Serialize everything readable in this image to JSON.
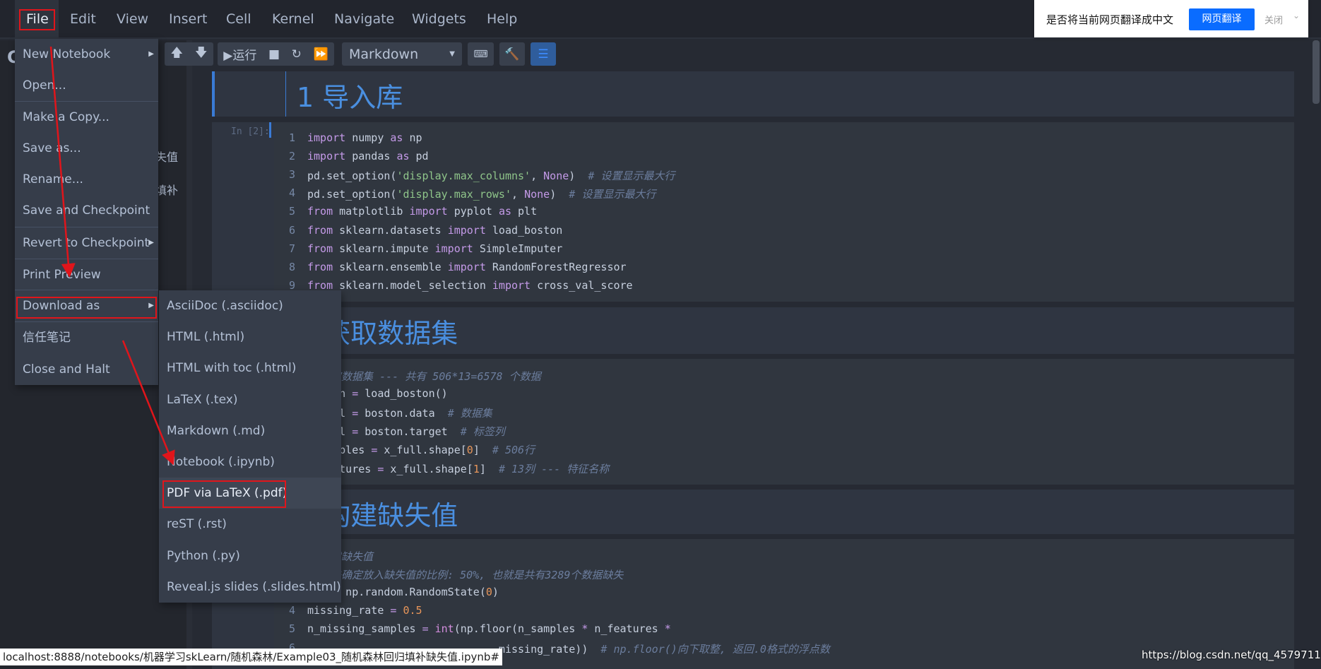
{
  "menubar": {
    "items": [
      "File",
      "Edit",
      "View",
      "Insert",
      "Cell",
      "Kernel",
      "Navigate",
      "Widgets",
      "Help"
    ]
  },
  "sidebar": {
    "letter": "C",
    "fragments": [
      "失值",
      "填补"
    ]
  },
  "toolbar": {
    "run_label": "运行",
    "cell_type": "Markdown",
    "icons": [
      "arrow-up-icon",
      "arrow-down-icon",
      "play-icon",
      "stop-icon",
      "restart-icon",
      "fast-forward-icon",
      "keyboard-icon",
      "hammer-icon",
      "list-icon"
    ],
    "active_color": "#2f5d9c"
  },
  "file_menu": {
    "items": [
      {
        "label": "New Notebook",
        "submenu": true
      },
      {
        "label": "Open..."
      },
      {
        "label": "Make a Copy..."
      },
      {
        "label": "Save as..."
      },
      {
        "label": "Rename..."
      },
      {
        "label": "Save and Checkpoint"
      },
      {
        "label": "Revert to Checkpoint",
        "submenu": true
      },
      {
        "label": "Print Preview"
      },
      {
        "label": "Download as",
        "submenu": true
      },
      {
        "label": "信任笔记"
      },
      {
        "label": "Close and Halt"
      }
    ]
  },
  "download_menu": {
    "items": [
      "AsciiDoc (.asciidoc)",
      "HTML (.html)",
      "HTML with toc (.html)",
      "LaTeX (.tex)",
      "Markdown (.md)",
      "Notebook (.ipynb)",
      "PDF via LaTeX (.pdf)",
      "reST (.rst)",
      "Python (.py)",
      "Reveal.js slides (.slides.html)"
    ],
    "highlighted": "PDF via LaTeX (.pdf)"
  },
  "notebook": {
    "headings": [
      "1  导入库",
      "2  获取数据集",
      "3  构建缺失值"
    ],
    "prompt": "In [2]:",
    "cell1": [
      [
        [
          "k",
          "import"
        ],
        [
          "t",
          " numpy "
        ],
        [
          "k",
          "as"
        ],
        [
          "t",
          " np"
        ]
      ],
      [
        [
          "k",
          "import"
        ],
        [
          "t",
          " pandas "
        ],
        [
          "k",
          "as"
        ],
        [
          "t",
          " pd"
        ]
      ],
      [
        [
          "t",
          "pd.set_option("
        ],
        [
          "s",
          "'display.max_columns'"
        ],
        [
          "t",
          ", "
        ],
        [
          "k",
          "None"
        ],
        [
          "t",
          ")  "
        ],
        [
          "c",
          "# 设置显示最大行"
        ]
      ],
      [
        [
          "t",
          "pd.set_option("
        ],
        [
          "s",
          "'display.max_rows'"
        ],
        [
          "t",
          ", "
        ],
        [
          "k",
          "None"
        ],
        [
          "t",
          ")  "
        ],
        [
          "c",
          "# 设置显示最大行"
        ]
      ],
      [
        [
          "k",
          "from"
        ],
        [
          "t",
          " matplotlib "
        ],
        [
          "k",
          "import"
        ],
        [
          "t",
          " pyplot "
        ],
        [
          "k",
          "as"
        ],
        [
          "t",
          " plt"
        ]
      ],
      [
        [
          "k",
          "from"
        ],
        [
          "t",
          " sklearn.datasets "
        ],
        [
          "k",
          "import"
        ],
        [
          "t",
          " load_boston"
        ]
      ],
      [
        [
          "k",
          "from"
        ],
        [
          "t",
          " sklearn.impute "
        ],
        [
          "k",
          "import"
        ],
        [
          "t",
          " SimpleImputer"
        ]
      ],
      [
        [
          "k",
          "from"
        ],
        [
          "t",
          " sklearn.ensemble "
        ],
        [
          "k",
          "import"
        ],
        [
          "t",
          " RandomForestRegressor"
        ]
      ],
      [
        [
          "k",
          "from"
        ],
        [
          "t",
          " sklearn.model_selection "
        ],
        [
          "k",
          "import"
        ],
        [
          "t",
          " cross_val_score"
        ]
      ]
    ],
    "cell2": [
      [
        [
          "c",
          "# 获取数据集 --- 共有 506*13=6578 个数据"
        ]
      ],
      [
        [
          "t",
          "boston "
        ],
        [
          "o",
          "="
        ],
        [
          "t",
          " load_boston()"
        ]
      ],
      [
        [
          "t",
          "x_full "
        ],
        [
          "o",
          "="
        ],
        [
          "t",
          " boston.data  "
        ],
        [
          "c",
          "# 数据集"
        ]
      ],
      [
        [
          "t",
          "y_full "
        ],
        [
          "o",
          "="
        ],
        [
          "t",
          " boston.target  "
        ],
        [
          "c",
          "# 标签列"
        ]
      ],
      [
        [
          "t",
          "n_samples "
        ],
        [
          "o",
          "="
        ],
        [
          "t",
          " x_full.shape["
        ],
        [
          "n",
          "0"
        ],
        [
          "t",
          "]  "
        ],
        [
          "c",
          "# 506行"
        ]
      ],
      [
        [
          "t",
          "n_features "
        ],
        [
          "o",
          "="
        ],
        [
          "t",
          " x_full.shape["
        ],
        [
          "n",
          "1"
        ],
        [
          "t",
          "]  "
        ],
        [
          "c",
          "# 13列 --- 特征名称"
        ]
      ]
    ],
    "cell3": [
      [
        [
          "c",
          "# 构建缺失值"
        ]
      ],
      [
        [
          "c",
          "# 首先确定放入缺失值的比例: 50%, 也就是共有3289个数据缺失"
        ]
      ],
      [
        [
          "t",
          "rng "
        ],
        [
          "o",
          "="
        ],
        [
          "t",
          " np.random.RandomState("
        ],
        [
          "n",
          "0"
        ],
        [
          "t",
          ")"
        ]
      ],
      [
        [
          "t",
          "missing_rate "
        ],
        [
          "o",
          "="
        ],
        [
          "t",
          " "
        ],
        [
          "n",
          "0.5"
        ]
      ],
      [
        [
          "t",
          "n_missing_samples "
        ],
        [
          "o",
          "="
        ],
        [
          "t",
          " "
        ],
        [
          "b",
          "int"
        ],
        [
          "t",
          "(np.floor(n_samples "
        ],
        [
          "o",
          "*"
        ],
        [
          "t",
          " n_features "
        ],
        [
          "o",
          "*"
        ]
      ],
      [
        [
          "t",
          "                              missing_rate))  "
        ],
        [
          "c",
          "# np.floor()向下取整, 返回.0格式的浮点数"
        ]
      ]
    ]
  },
  "translate_bar": {
    "prompt": "是否将当前网页翻译成中文",
    "translate_button": "网页翻译",
    "close_label": "关闭",
    "accent": "#0a6cff"
  },
  "status_url": "localhost:8888/notebooks/机器学习skLearn/随机森林/Example03_随机森林回归填补缺失值.ipynb#",
  "watermark": "https://blog.csdn.net/qq_45797116",
  "annotation_color": "#e0151b"
}
